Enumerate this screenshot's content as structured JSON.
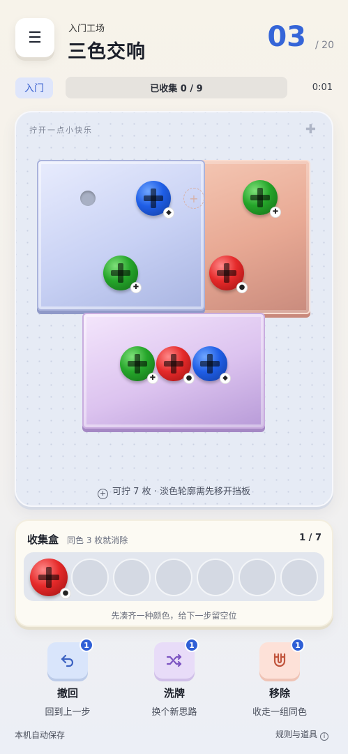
{
  "header": {
    "menu_icon": "menu-icon",
    "subtitle": "入门工场",
    "title": "三色交响",
    "level": "03",
    "level_total": "/ 20"
  },
  "status": {
    "mode": "入门",
    "collected": "已收集 0 / 9",
    "timer": "0:01"
  },
  "board": {
    "hint": "拧开一点小快乐",
    "corner_icon": "plus-icon",
    "footer_icon": "plus-circle-icon",
    "footer_text": "可拧 7 枚 · 淡色轮廓需先移开挡板",
    "colors": {
      "blue": "#1f5ee6",
      "green": "#25a52a",
      "red": "#e52a2a"
    }
  },
  "screws": [
    {
      "color": "blue",
      "mark": "◆"
    },
    {
      "color": "green",
      "mark": "✚"
    },
    {
      "color": "green",
      "mark": "✚"
    },
    {
      "color": "red",
      "mark": "●"
    },
    {
      "color": "green",
      "mark": "✚"
    },
    {
      "color": "red",
      "mark": "●"
    },
    {
      "color": "blue",
      "mark": "◆"
    }
  ],
  "collect": {
    "title": "收集盒",
    "rule": "同色 3 枚就消除",
    "count": "1 / 7",
    "slots": [
      {
        "filled": true,
        "color": "red",
        "mark": "●"
      },
      {
        "filled": false
      },
      {
        "filled": false
      },
      {
        "filled": false
      },
      {
        "filled": false
      },
      {
        "filled": false
      },
      {
        "filled": false
      }
    ],
    "hint": "先凑齐一种颜色，给下一步留空位"
  },
  "tools": [
    {
      "icon": "undo-icon",
      "badge": "1",
      "label": "撤回",
      "sub": "回到上一步"
    },
    {
      "icon": "shuffle-icon",
      "badge": "1",
      "label": "洗牌",
      "sub": "换个新思路"
    },
    {
      "icon": "magnet-icon",
      "badge": "1",
      "label": "移除",
      "sub": "收走一组同色"
    }
  ],
  "footer": {
    "autosave": "本机自动保存",
    "rules": "规则与道具",
    "rules_icon": "info-icon"
  }
}
